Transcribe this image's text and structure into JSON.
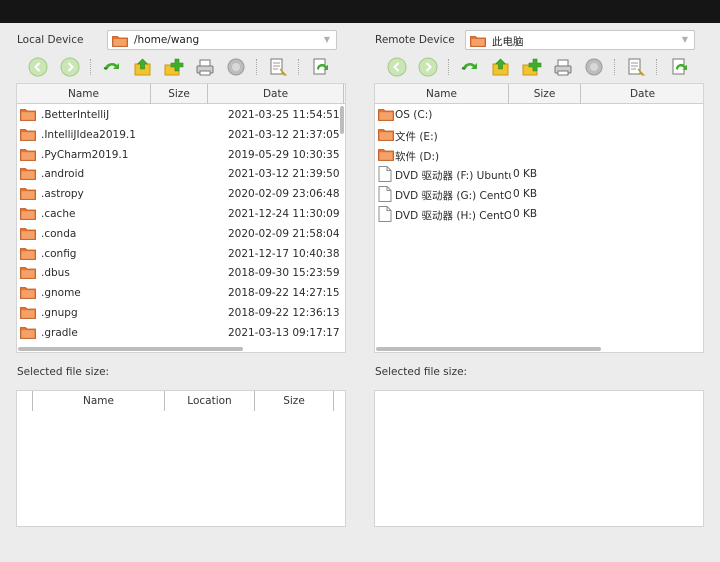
{
  "local": {
    "device_label": "Local Device",
    "path": "/home/wang",
    "columns": {
      "name": "Name",
      "size": "Size",
      "date": "Date"
    },
    "files": [
      {
        "name": ".BetterIntelliJ",
        "size": "",
        "date": "2021-03-25 11:54:51"
      },
      {
        "name": ".IntelliJIdea2019.1",
        "size": "",
        "date": "2021-03-12 21:37:05"
      },
      {
        "name": ".PyCharm2019.1",
        "size": "",
        "date": "2019-05-29 10:30:35"
      },
      {
        "name": ".android",
        "size": "",
        "date": "2021-03-12 21:39:50"
      },
      {
        "name": ".astropy",
        "size": "",
        "date": "2020-02-09 23:06:48"
      },
      {
        "name": ".cache",
        "size": "",
        "date": "2021-12-24 11:30:09"
      },
      {
        "name": ".conda",
        "size": "",
        "date": "2020-02-09 21:58:04"
      },
      {
        "name": ".config",
        "size": "",
        "date": "2021-12-17 10:40:38"
      },
      {
        "name": ".dbus",
        "size": "",
        "date": "2018-09-30 15:23:59"
      },
      {
        "name": ".gnome",
        "size": "",
        "date": "2018-09-22 14:27:15"
      },
      {
        "name": ".gnupg",
        "size": "",
        "date": "2018-09-22 12:36:13"
      },
      {
        "name": ".gradle",
        "size": "",
        "date": "2021-03-13 09:17:17"
      }
    ],
    "selected_size_label": "Selected file size:",
    "queue_columns": {
      "name": "Name",
      "location": "Location",
      "size": "Size"
    }
  },
  "remote": {
    "device_label": "Remote Device",
    "path": "此电脑",
    "columns": {
      "name": "Name",
      "size": "Size",
      "date": "Date"
    },
    "files": [
      {
        "name": "OS (C:)",
        "size": "",
        "date": "",
        "icon": "folder"
      },
      {
        "name": "文件 (E:)",
        "size": "",
        "date": "",
        "icon": "folder"
      },
      {
        "name": "软件 (D:)",
        "size": "",
        "date": "",
        "icon": "folder"
      },
      {
        "name": "DVD 驱动器 (F:) Ubuntu",
        "size": "0 KB",
        "date": "",
        "icon": "file"
      },
      {
        "name": "DVD 驱动器 (G:) CentOS",
        "size": "0 KB",
        "date": "",
        "icon": "file"
      },
      {
        "name": "DVD 驱动器 (H:) CentOS",
        "size": "0 KB",
        "date": "",
        "icon": "file"
      }
    ],
    "selected_size_label": "Selected file size:"
  },
  "icons": {
    "back": "back-icon",
    "forward": "forward-icon",
    "refresh": "refresh-icon",
    "up": "parent-folder-icon",
    "new_folder": "new-folder-icon",
    "print": "printer-icon",
    "stop": "stop-icon",
    "properties": "properties-icon",
    "sync": "sync-icon"
  },
  "colors": {
    "folder": "#e8742a",
    "arrow_green": "#3fae2a",
    "topbar": "#151515"
  }
}
